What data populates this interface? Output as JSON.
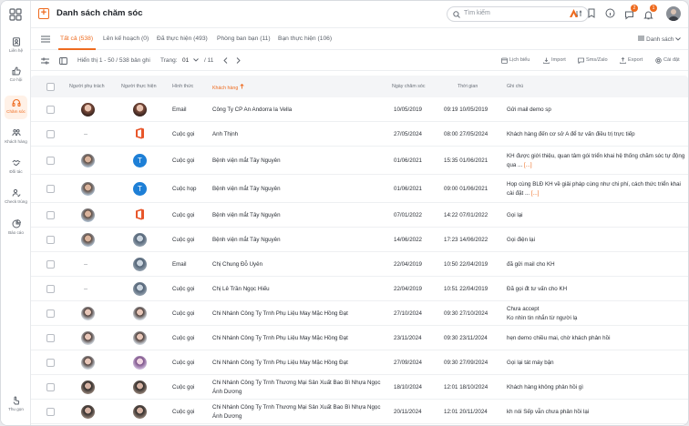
{
  "header": {
    "title": "Danh sách chăm sóc",
    "search_placeholder": "Tìm kiếm",
    "badge_messages": "2",
    "badge_notifications": "1"
  },
  "sidebar": {
    "items": [
      {
        "label": "Liên hệ",
        "icon": "contacts-icon"
      },
      {
        "label": "Cơ hội",
        "icon": "thumbs-up-icon"
      },
      {
        "label": "Chăm sóc",
        "icon": "headset-icon",
        "active": true
      },
      {
        "label": "Khách hàng",
        "icon": "customers-icon"
      },
      {
        "label": "Đối tác",
        "icon": "handshake-icon"
      },
      {
        "label": "Check trùng",
        "icon": "check-duplicate-icon"
      },
      {
        "label": "Báo cáo",
        "icon": "report-icon"
      }
    ],
    "bottom_label": "Thu gọn"
  },
  "tabs": [
    {
      "label": "Tất cả (538)",
      "active": true
    },
    {
      "label": "Lên kế hoạch (0)"
    },
    {
      "label": "Đã thực hiện (493)"
    },
    {
      "label": "Phòng ban bạn (11)"
    },
    {
      "label": "Bạn thực hiện (106)"
    }
  ],
  "tabs_right": "Danh sách",
  "toolbar": {
    "showing": "Hiển thị 1 - 50 / 538 bản ghi",
    "page_label": "Trang:",
    "page_value": "01",
    "page_total": "/ 11",
    "actions": [
      "Lịch biểu",
      "Import",
      "Sms/Zalo",
      "Export",
      "Cài đặt"
    ]
  },
  "columns": [
    "Người phụ trách",
    "Người thực hiện",
    "Hình thức",
    "Khách hàng",
    "Ngày chăm sóc",
    "Thời gian",
    "Ghi chú"
  ],
  "accent": "#ee6b1f",
  "rows": [
    {
      "owner": "a1",
      "doer": "a1",
      "type": "Email",
      "customer": "Công Ty CP An Andorra la Vella",
      "date": "10/05/2019",
      "time": "09:19 10/05/2019",
      "note": "Gửi mail demo sp"
    },
    {
      "owner": "--",
      "doer": "office",
      "type": "Cuộc gọi",
      "customer": "Anh Thịnh",
      "date": "27/05/2024",
      "time": "08:00 27/05/2024",
      "note": "Khách hàng đến cơ sở A để tư vấn điều trị trực tiếp"
    },
    {
      "owner": "a2",
      "doer": "T",
      "type": "Cuộc gọi",
      "customer": "Bệnh viện mắt Tây Nguyên",
      "date": "01/06/2021",
      "time": "15:35 01/06/2021",
      "note": "KH được giới thiệu, quan tâm gói triển khai hệ thống chăm sóc tự động qua ...",
      "more": "[...]"
    },
    {
      "owner": "a2",
      "doer": "T",
      "type": "Cuộc họp",
      "customer": "Bệnh viện mắt Tây Nguyên",
      "date": "01/06/2021",
      "time": "09:00 01/06/2021",
      "note": "Họp cùng BLĐ KH về giải pháp cùng như chi phí, cách thức triển khai cài đặt ...",
      "more": "[...]"
    },
    {
      "owner": "a2",
      "doer": "office",
      "type": "Cuộc gọi",
      "customer": "Bệnh viện mắt Tây Nguyên",
      "date": "07/01/2022",
      "time": "14:22 07/01/2022",
      "note": "Gọi lại"
    },
    {
      "owner": "a2",
      "doer": "a3",
      "type": "Cuộc gọi",
      "customer": "Bệnh viện mắt Tây Nguyên",
      "date": "14/06/2022",
      "time": "17:23 14/06/2022",
      "note": "Gọi điện lại"
    },
    {
      "owner": "--",
      "doer": "a3",
      "type": "Email",
      "customer": "Chị Chung Đỗ Uyên",
      "date": "22/04/2019",
      "time": "10:50 22/04/2019",
      "note": "đã gửi mail cho KH"
    },
    {
      "owner": "--",
      "doer": "a3",
      "type": "Cuộc gọi",
      "customer": "Chị Lê Trần Ngọc Hiếu",
      "date": "22/04/2019",
      "time": "10:51 22/04/2019",
      "note": "Đã gọi đt tư vấn cho KH"
    },
    {
      "owner": "a4",
      "doer": "a4",
      "type": "Cuộc gọi",
      "customer": "Chi Nhánh Công Ty Trnh Phụ Liệu May Mặc Hồng Đạt",
      "date": "27/10/2024",
      "time": "09:30 27/10/2024",
      "note": "Chưa accept\nKo nhìn tin nhắn từ người lạ"
    },
    {
      "owner": "a4",
      "doer": "a4",
      "type": "Cuộc gọi",
      "customer": "Chi Nhánh Công Ty Trnh Phụ Liệu May Mặc Hồng Đạt",
      "date": "23/11/2024",
      "time": "09:30 23/11/2024",
      "note": "hẹn demo chiều mai, chờ khách phản hồi"
    },
    {
      "owner": "a4",
      "doer": "a6",
      "type": "Cuộc gọi",
      "customer": "Chi Nhánh Công Ty Trnh Phụ Liệu May Mặc Hồng Đạt",
      "date": "27/09/2024",
      "time": "09:30 27/09/2024",
      "note": "Gọi lại tát máy bận"
    },
    {
      "owner": "a5",
      "doer": "a5",
      "type": "Cuộc gọi",
      "customer": "Chi Nhánh Công Ty Trnh Thương Mại Sản Xuất Bao Bì Nhựa Ngọc Ánh Dương",
      "date": "18/10/2024",
      "time": "12:01 18/10/2024",
      "note": "Khách hàng không phản hồi gì"
    },
    {
      "owner": "a5",
      "doer": "a5",
      "type": "Cuộc gọi",
      "customer": "Chi Nhánh Công Ty Trnh Thương Mại Sản Xuất Bao Bì Nhựa Ngọc Ánh Dương",
      "date": "20/11/2024",
      "time": "12:01 20/11/2024",
      "note": "kh nói Sếp vẫn chưa phản hồi lại"
    }
  ]
}
